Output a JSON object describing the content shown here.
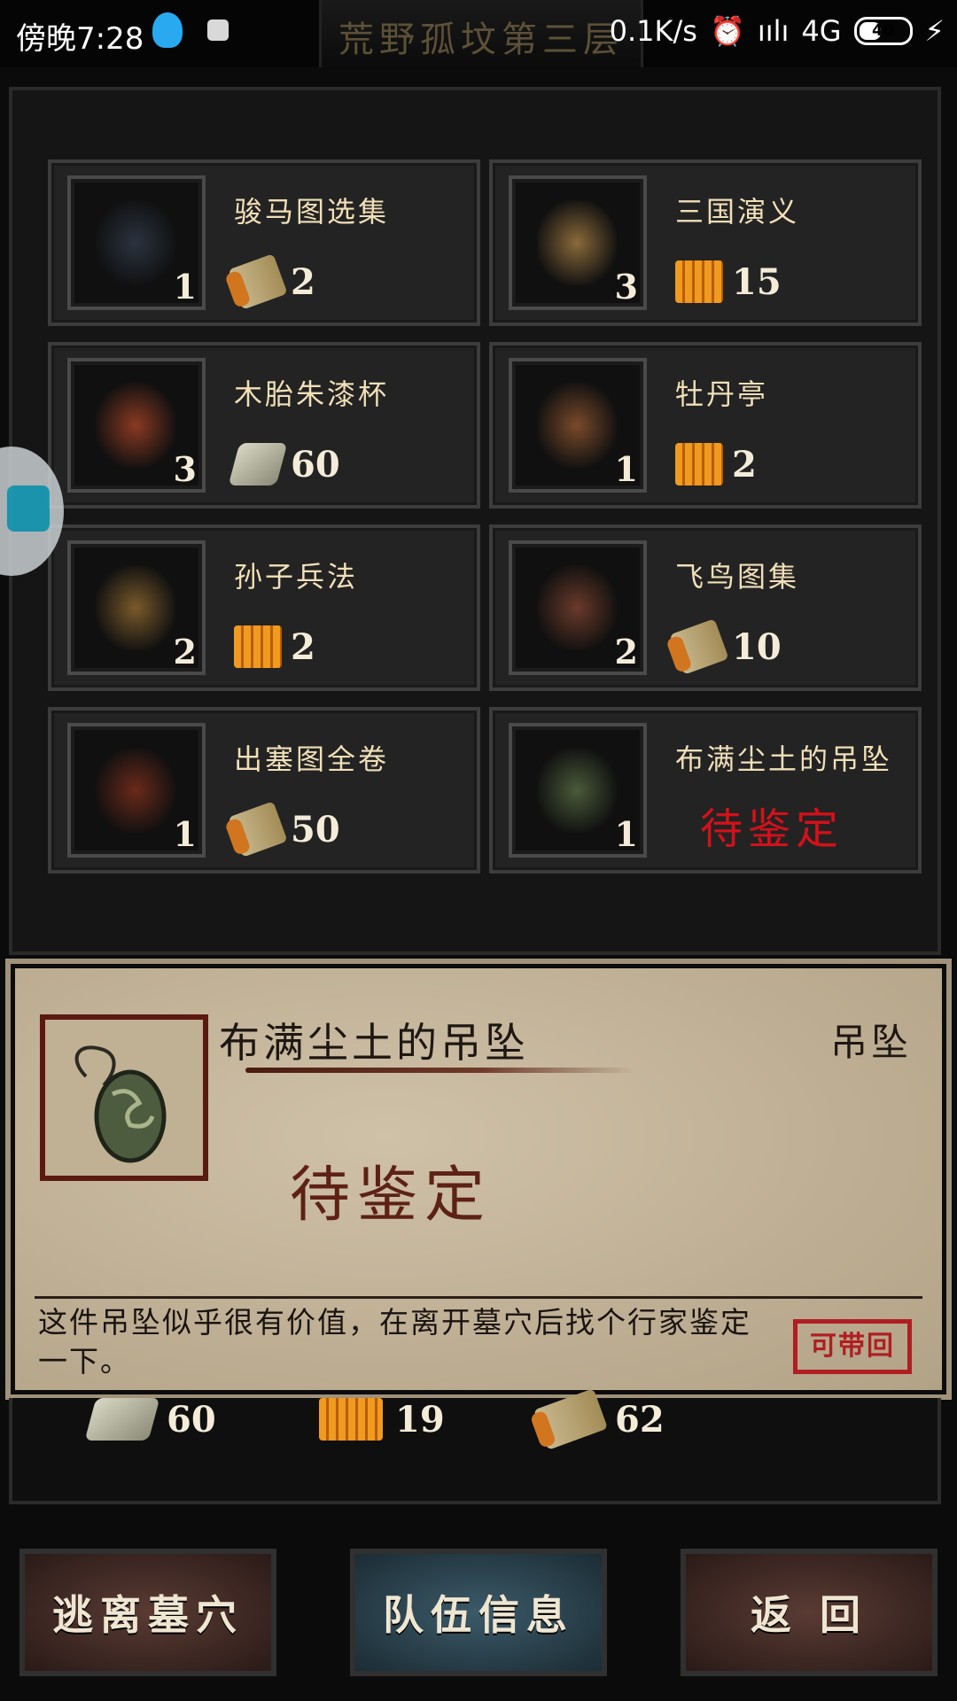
{
  "status_bar": {
    "time": "傍晚7:28",
    "speed": "0.1K/s",
    "network": "4G",
    "battery": "40",
    "location_title": "荒野孤坟第三层"
  },
  "inventory": [
    {
      "name": "骏马图选集",
      "count": "1",
      "price": "2",
      "currency": "scroll-icon",
      "art_color": "#2b3340"
    },
    {
      "name": "三国演义",
      "count": "3",
      "price": "15",
      "currency": "book-icon",
      "art_color": "#8a6a3a"
    },
    {
      "name": "木胎朱漆杯",
      "count": "3",
      "price": "60",
      "currency": "cash-icon",
      "art_color": "#8a3a22"
    },
    {
      "name": "牡丹亭",
      "count": "1",
      "price": "2",
      "currency": "book-icon",
      "art_color": "#7a4a2a"
    },
    {
      "name": "孙子兵法",
      "count": "2",
      "price": "2",
      "currency": "book-icon",
      "art_color": "#7a5a2a"
    },
    {
      "name": "飞鸟图集",
      "count": "2",
      "price": "10",
      "currency": "scroll-icon",
      "art_color": "#6a3a2a"
    },
    {
      "name": "出塞图全卷",
      "count": "1",
      "price": "50",
      "currency": "scroll-icon",
      "art_color": "#6a2a1a"
    },
    {
      "name": "布满尘土的吊坠",
      "count": "1",
      "price": "待鉴定",
      "currency": "none",
      "art_color": "#4a5a3a"
    }
  ],
  "detail": {
    "title": "布满尘土的吊坠",
    "type": "吊坠",
    "status": "待鉴定",
    "description": "这件吊坠似乎很有价值，在离开墓穴后找个行家鉴定一下。",
    "stamp": "可带回"
  },
  "totals": [
    {
      "currency": "cash-icon",
      "value": "60"
    },
    {
      "currency": "book-icon",
      "value": "19"
    },
    {
      "currency": "scroll-icon",
      "value": "62"
    }
  ],
  "buttons": {
    "escape": "逃离墓穴",
    "team": "队伍信息",
    "back": "返 回"
  },
  "colors": {
    "pending_red": "#d3111a",
    "stamp_red": "#b01e22",
    "parchment": "#c2b39a"
  }
}
